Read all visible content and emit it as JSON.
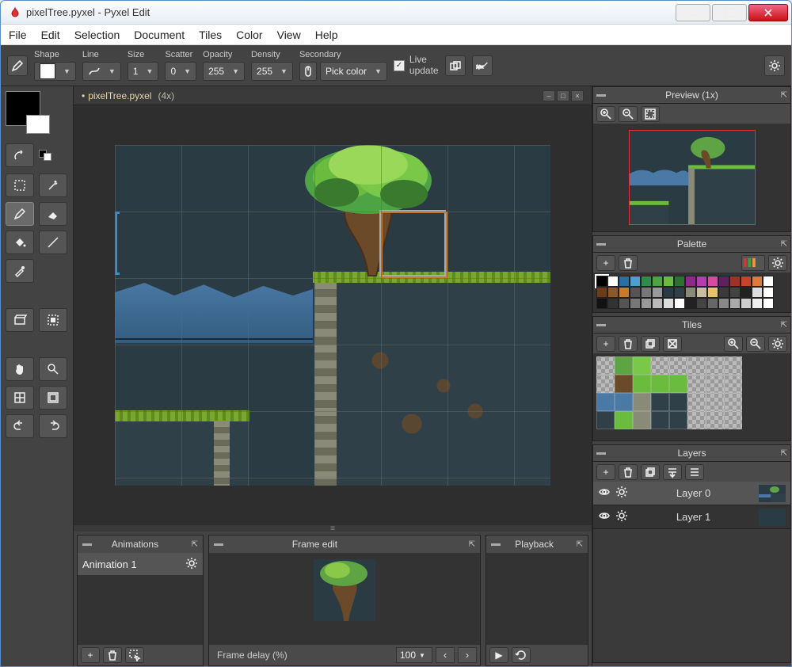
{
  "window": {
    "title": "pixelTree.pyxel - Pyxel Edit"
  },
  "menu": [
    "File",
    "Edit",
    "Selection",
    "Document",
    "Tiles",
    "Color",
    "View",
    "Help"
  ],
  "toolbar": {
    "shape": "Shape",
    "line": "Line",
    "size": "Size",
    "scatter": "Scatter",
    "opacity": "Opacity",
    "density": "Density",
    "secondary": "Secondary",
    "size_val": "1",
    "scatter_val": "0",
    "opacity_val": "255",
    "density_val": "255",
    "pick_color": "Pick color",
    "live_update": "Live\nupdate",
    "live_checked": "✓"
  },
  "doc": {
    "modified": "•",
    "name": "pixelTree.pyxel",
    "zoom": "(4x)"
  },
  "panels": {
    "animations": "Animations",
    "frame_edit": "Frame edit",
    "playback": "Playback",
    "preview": "Preview (1x)",
    "palette": "Palette",
    "tiles": "Tiles",
    "layers": "Layers"
  },
  "animations": {
    "item": "Animation 1"
  },
  "frame": {
    "delay_label": "Frame delay (%)",
    "delay_val": "100"
  },
  "layers": [
    {
      "name": "Layer 0",
      "active": true
    },
    {
      "name": "Layer 1",
      "active": false
    }
  ],
  "palette_colors": [
    "#000000",
    "#ffffff",
    "#2a6fa0",
    "#4aa0d0",
    "#2c8c4a",
    "#4ea344",
    "#6bbb3f",
    "#2e7032",
    "#8a2a8a",
    "#b23fb2",
    "#d74aa0",
    "#602060",
    "#a0302a",
    "#c7442a",
    "#de7a3a",
    "#ffffff",
    "#6b3b1a",
    "#8c5a2a",
    "#c97b2c",
    "#555555",
    "#777777",
    "#999999",
    "#2a3b44",
    "#304048",
    "#8a8a78",
    "#c7bfa0",
    "#e6c36b",
    "#3a3a3a",
    "#434343",
    "#222222",
    "#dddddd",
    "#ffffff",
    "#111111",
    "#333333",
    "#555555",
    "#777777",
    "#999999",
    "#bbbbbb",
    "#dddddd",
    "#ffffff",
    "#222222",
    "#444444",
    "#666666",
    "#888888",
    "#aaaaaa",
    "#cccccc",
    "#eeeeee",
    "#ffffff"
  ]
}
